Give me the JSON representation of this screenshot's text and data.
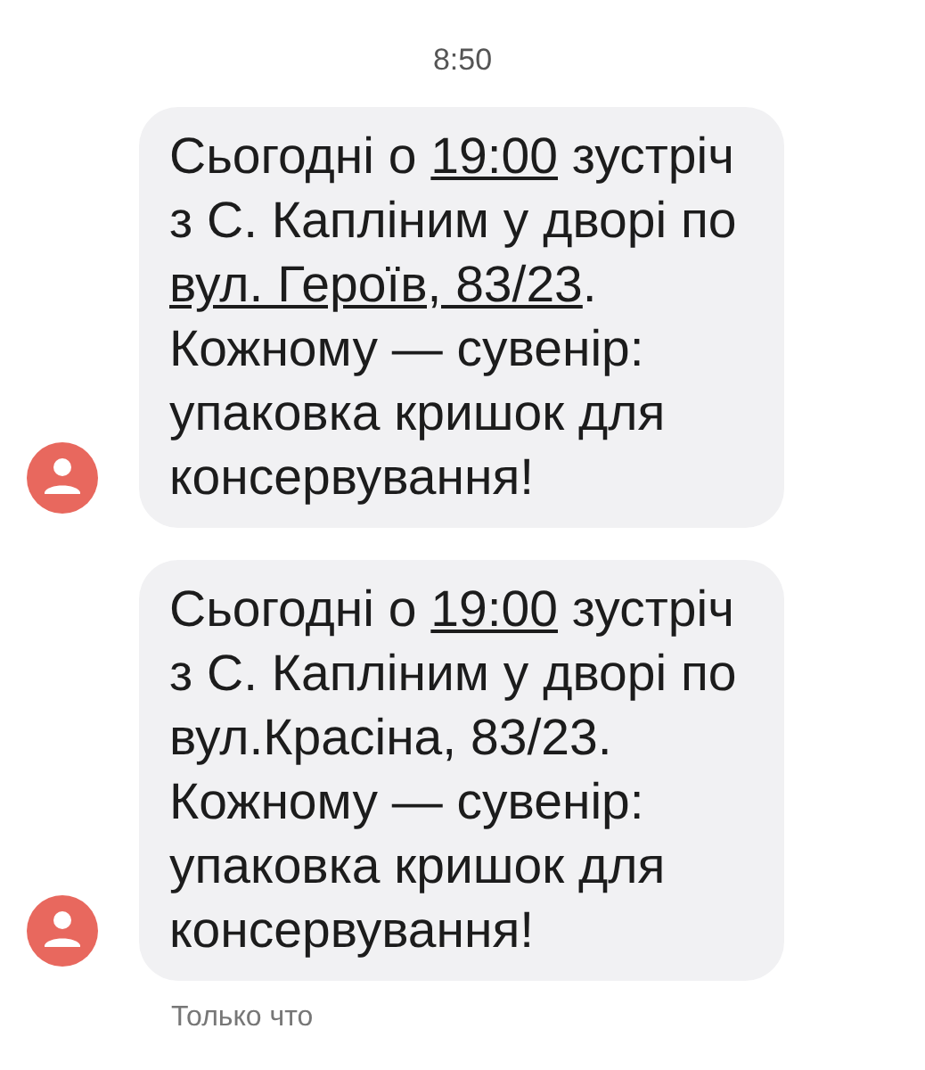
{
  "timestamp": "8:50",
  "messages": [
    {
      "parts": [
        {
          "text": "Сьогодні о ",
          "link": false
        },
        {
          "text": "19:00",
          "link": true
        },
        {
          "text": " зустріч з С. Капліним у дворі по ",
          "link": false
        },
        {
          "text": "вул. Героїв, 83/23",
          "link": true
        },
        {
          "text": ". Кожному — сувенір: упаковка кришок для консервування!",
          "link": false
        }
      ]
    },
    {
      "parts": [
        {
          "text": "Сьогодні о ",
          "link": false
        },
        {
          "text": "19:00",
          "link": true
        },
        {
          "text": " зустріч з С. Капліним у дворі по вул.Красіна, 83/23. Кожному — сувенір: упаковка кришок для консервування!",
          "link": false
        }
      ]
    }
  ],
  "status": "Только что"
}
